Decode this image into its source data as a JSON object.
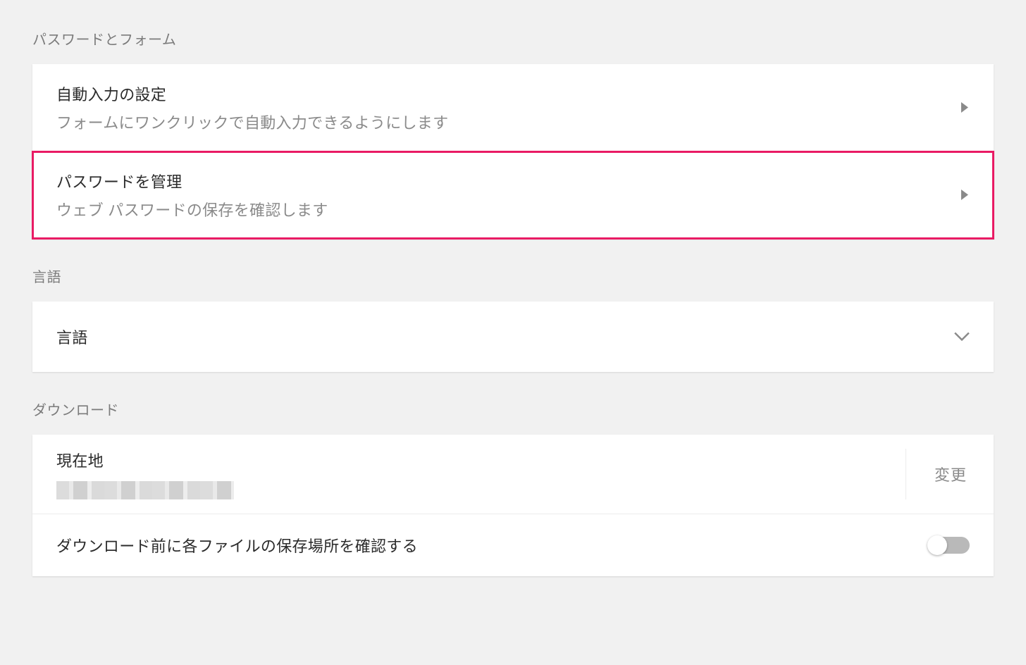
{
  "sections": {
    "passwords_forms": {
      "title": "パスワードとフォーム",
      "autofill": {
        "title": "自動入力の設定",
        "subtitle": "フォームにワンクリックで自動入力できるようにします"
      },
      "manage_passwords": {
        "title": "パスワードを管理",
        "subtitle": "ウェブ パスワードの保存を確認します"
      }
    },
    "language": {
      "title": "言語",
      "item_label": "言語"
    },
    "download": {
      "title": "ダウンロード",
      "location_label": "現在地",
      "change_button": "変更",
      "ask_before_label": "ダウンロード前に各ファイルの保存場所を確認する",
      "ask_before_value": false
    }
  }
}
